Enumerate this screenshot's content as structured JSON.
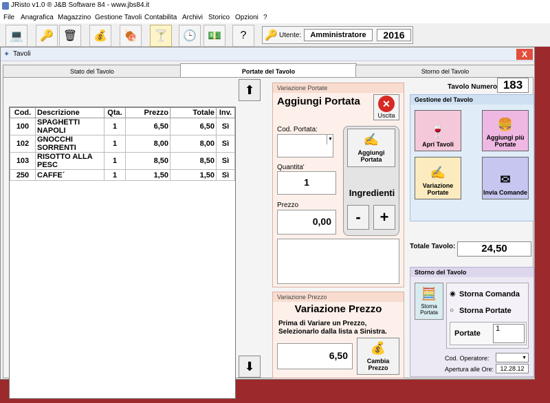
{
  "app": {
    "title": "JRisto v1.0 ® J&B Software 84 - www.jbs84.it"
  },
  "menu": [
    "File",
    "Anagrafica",
    "Magazzino",
    "Gestione Tavoli",
    "Contabilita",
    "Archivi",
    "Storico",
    "Opzioni",
    "?"
  ],
  "toolbar": {
    "buttons": [
      "computer-icon",
      "keys-icon",
      "trash-icon",
      "coins-icon",
      "ham-icon",
      "waiter-icon",
      "clock-icon",
      "money-icon",
      "help-icon"
    ],
    "user_label": "Utente:",
    "user_value": "Amministratore",
    "year": "2016"
  },
  "window": {
    "title": "Tavoli",
    "close": "X"
  },
  "tabs": [
    "Stato del Tavolo",
    "Portate del Tavolo",
    "Storno del Tavolo"
  ],
  "grid": {
    "columns": [
      "Cod.",
      "Descrizione",
      "Qta.",
      "Prezzo",
      "Totale",
      "Inv."
    ],
    "rows": [
      [
        "100",
        "SPAGHETTI NAPOLI",
        "1",
        "6,50",
        "6,50",
        "Sì"
      ],
      [
        "102",
        "GNOCCHI SORRENTI",
        "1",
        "8,00",
        "8,00",
        "Sì"
      ],
      [
        "103",
        "RISOTTO ALLA PESC",
        "1",
        "8,50",
        "8,50",
        "Sì"
      ],
      [
        "250",
        "CAFFE´",
        "1",
        "1,50",
        "1,50",
        "Sì"
      ]
    ]
  },
  "variazione_portate": {
    "header": "Variazione Portate",
    "title": "Aggiungi Portata",
    "exit_label": "Uscita",
    "cod_label": "Cod. Portata:",
    "cod_value": "",
    "add_button": "Aggiungi Portata",
    "qty_label": "Quantita'",
    "qty_value": "1",
    "ingredients_label": "Ingredienti",
    "minus": "-",
    "plus": "+",
    "price_label": "Prezzo",
    "price_value": "0,00"
  },
  "variazione_prezzo": {
    "header": "Variazione Prezzo",
    "title": "Variazione Prezzo",
    "note": "Prima di Variare un Prezzo, Selezionarlo dalla lista a Sinistra.",
    "value": "6,50",
    "button": "Cambia Prezzo"
  },
  "table_info": {
    "label": "Tavolo Numero:",
    "value": "183"
  },
  "gestione": {
    "header": "Gestione del Tavolo",
    "buttons": [
      "Apri Tavoli",
      "Aggiungi più Portate",
      "Variazione Portate",
      "Invia Comande"
    ],
    "total_label": "Totale Tavolo:",
    "total_value": "24,50"
  },
  "storno": {
    "header": "Storno del Tavolo",
    "button": "Storna Portata",
    "option1": "Storna Comanda",
    "option2": "Storna Portate",
    "portate_label": "Portate",
    "portate_value": "1",
    "operator_label": "Cod. Operatore:",
    "opening_label": "Apertura alle Ore:",
    "opening_value": "12.28.12"
  }
}
